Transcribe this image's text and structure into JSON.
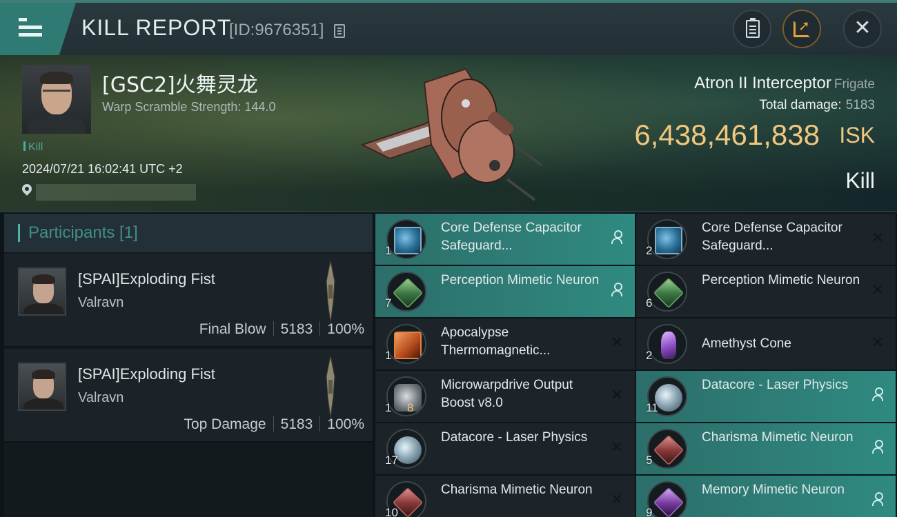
{
  "header": {
    "title": "KILL REPORT",
    "report_id": "[ID:9676351]"
  },
  "victim": {
    "name": "[GSC2]火舞灵龙",
    "warp_scramble": "Warp Scramble Strength: 144.0",
    "kill_tag": "Kill",
    "datetime": "2024/07/21 16:02:41 UTC +2"
  },
  "ship": {
    "name": "Atron II Interceptor",
    "class": "Frigate",
    "total_damage_label": "Total damage:",
    "total_damage_value": "5183",
    "isk_value": "6,438,461,838",
    "isk_unit": "ISK",
    "kill_label": "Kill"
  },
  "participants": {
    "header": "Participants [1]",
    "rows": [
      {
        "name": "[SPAI]Exploding Fist",
        "ship": "Valravn",
        "label": "Final Blow",
        "damage": "5183",
        "percent": "100%"
      },
      {
        "name": "[SPAI]Exploding Fist",
        "ship": "Valravn",
        "label": "Top Damage",
        "damage": "5183",
        "percent": "100%"
      }
    ]
  },
  "items": [
    {
      "name": "Core Defense Capacitor Safeguard...",
      "qty": "1",
      "status": "dropped",
      "icon": "capacitor-icon"
    },
    {
      "name": "Core Defense Capacitor Safeguard...",
      "qty": "2",
      "status": "destroyed",
      "icon": "capacitor-icon"
    },
    {
      "name": "Perception Mimetic Neuron",
      "qty": "7",
      "status": "dropped",
      "icon": "green-neuron-icon"
    },
    {
      "name": "Perception Mimetic Neuron",
      "qty": "6",
      "status": "destroyed",
      "icon": "green-neuron-icon"
    },
    {
      "name": "Apocalypse Thermomagnetic...",
      "qty": "1",
      "status": "destroyed",
      "icon": "blueprint-icon"
    },
    {
      "name": "Amethyst Cone",
      "qty": "2",
      "status": "destroyed",
      "icon": "crystal-icon"
    },
    {
      "name": "Microwarpdrive Output Boost v8.0",
      "qty": "1",
      "qty_extra": "8",
      "status": "destroyed",
      "icon": "module-icon"
    },
    {
      "name": "Datacore - Laser Physics",
      "qty": "11",
      "status": "dropped",
      "icon": "datacore-icon"
    },
    {
      "name": "Datacore - Laser Physics",
      "qty": "17",
      "status": "destroyed",
      "icon": "datacore-icon"
    },
    {
      "name": "Charisma Mimetic Neuron",
      "qty": "5",
      "status": "dropped",
      "icon": "red-neuron-icon"
    },
    {
      "name": "Charisma Mimetic Neuron",
      "qty": "10",
      "status": "destroyed",
      "icon": "red-neuron-icon"
    },
    {
      "name": "Memory Mimetic Neuron",
      "qty": "9",
      "status": "dropped",
      "icon": "purple-neuron-icon"
    }
  ],
  "colors": {
    "accent": "#2f8a80",
    "isk": "#f0c77e",
    "share": "#e4a13c"
  }
}
